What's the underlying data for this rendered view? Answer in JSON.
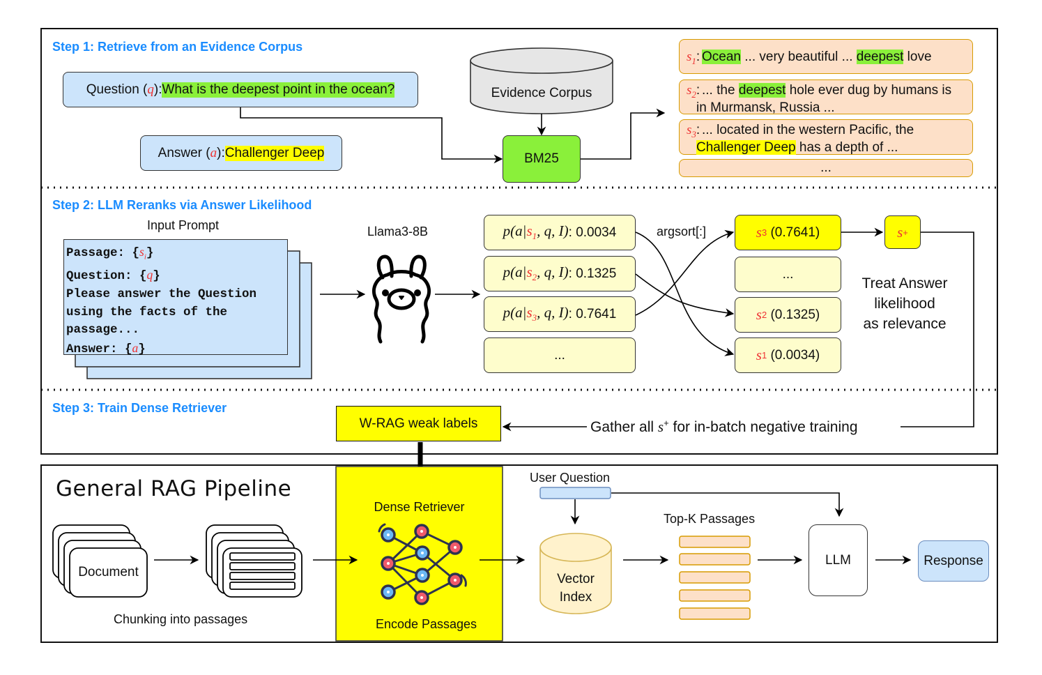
{
  "step1": {
    "title": "Step 1: Retrieve from an Evidence Corpus",
    "question_prefix": "Question (",
    "question_var": "q",
    "question_suffix": "): ",
    "question_text": "What is the deepest point in the ocean?",
    "answer_prefix": "Answer (",
    "answer_var": "a",
    "answer_suffix": "): ",
    "answer_text": "Challenger Deep",
    "corpus_label": "Evidence Corpus",
    "retriever_label": "BM25",
    "passages": [
      {
        "tag": "s",
        "sub": "1",
        "segments": [
          {
            "text": "Ocean",
            "hl": "green"
          },
          {
            "text": " ... very beautiful ... ",
            "hl": ""
          },
          {
            "text": "deepest",
            "hl": "green"
          },
          {
            "text": " love",
            "hl": ""
          }
        ]
      },
      {
        "tag": "s",
        "sub": "2",
        "segments": [
          {
            "text": " ... the ",
            "hl": ""
          },
          {
            "text": "deepest",
            "hl": "green"
          },
          {
            "text": " hole ever dug by humans is in Murmansk, Russia ...",
            "hl": ""
          }
        ]
      },
      {
        "tag": "s",
        "sub": "3",
        "segments": [
          {
            "text": " ... located in the western Pacific, the ",
            "hl": ""
          },
          {
            "text": "Challenger Deep",
            "hl": "yellow"
          },
          {
            "text": " has a depth of ...",
            "hl": ""
          }
        ]
      }
    ],
    "passages_more": "..."
  },
  "step2": {
    "title": "Step 2: LLM Reranks via Answer Likelihood",
    "prompt_heading": "Input Prompt",
    "prompt_lines": [
      {
        "text": "Passage: {",
        "var": "s",
        "sub": "i",
        "end": "}"
      },
      {
        "text": "Question: {",
        "var": "q",
        "sub": "",
        "end": "}"
      },
      {
        "text": "Please answer the Question",
        "var": "",
        "sub": "",
        "end": ""
      },
      {
        "text": "using the facts of the",
        "var": "",
        "sub": "",
        "end": ""
      },
      {
        "text": "passage...",
        "var": "",
        "sub": "",
        "end": ""
      },
      {
        "text": "Answer: {",
        "var": "a",
        "sub": "",
        "end": "}"
      }
    ],
    "model_label": "Llama3-8B",
    "likelihoods": [
      {
        "sub": "1",
        "value": "0.0034"
      },
      {
        "sub": "2",
        "value": "0.1325"
      },
      {
        "sub": "3",
        "value": "0.7641"
      }
    ],
    "likelihood_more": "...",
    "sort_label": "argsort[:]",
    "ranked": [
      {
        "sub": "3",
        "value": "(0.7641)",
        "top": true
      },
      {
        "sub": "",
        "value": "...",
        "top": false
      },
      {
        "sub": "2",
        "value": "(0.1325)",
        "top": false
      },
      {
        "sub": "1",
        "value": "(0.0034)",
        "top": false
      }
    ],
    "positive_label": "s",
    "positive_sup": "+",
    "note_lines": [
      "Treat Answer",
      "likelihood",
      "as relevance"
    ]
  },
  "step3": {
    "title": "Step 3: Train Dense Retriever",
    "weak_labels": "W-RAG weak labels",
    "gather_prefix": "Gather all ",
    "gather_var": "s",
    "gather_sup": "+",
    "gather_suffix": " for in-batch negative training"
  },
  "pipeline": {
    "title": "General RAG Pipeline",
    "document_label": "Document",
    "chunking_label": "Chunking into passages",
    "retriever_title": "Dense Retriever",
    "retriever_caption": "Encode Passages",
    "user_question_label": "User Question",
    "vector_index_lines": [
      "Vector",
      "Index"
    ],
    "topk_label": "Top-K Passages",
    "llm_label": "LLM",
    "response_label": "Response"
  },
  "colors": {
    "step_title": "#1a8cff",
    "query_box": "#cce4fb",
    "bm25": "#8af03a",
    "passage": "#fde0c8",
    "passage_border": "#d79b00",
    "likelihood_box": "#fefdcc",
    "highlight_yellow": "#fffe00",
    "variable_red": "#ee3333"
  }
}
